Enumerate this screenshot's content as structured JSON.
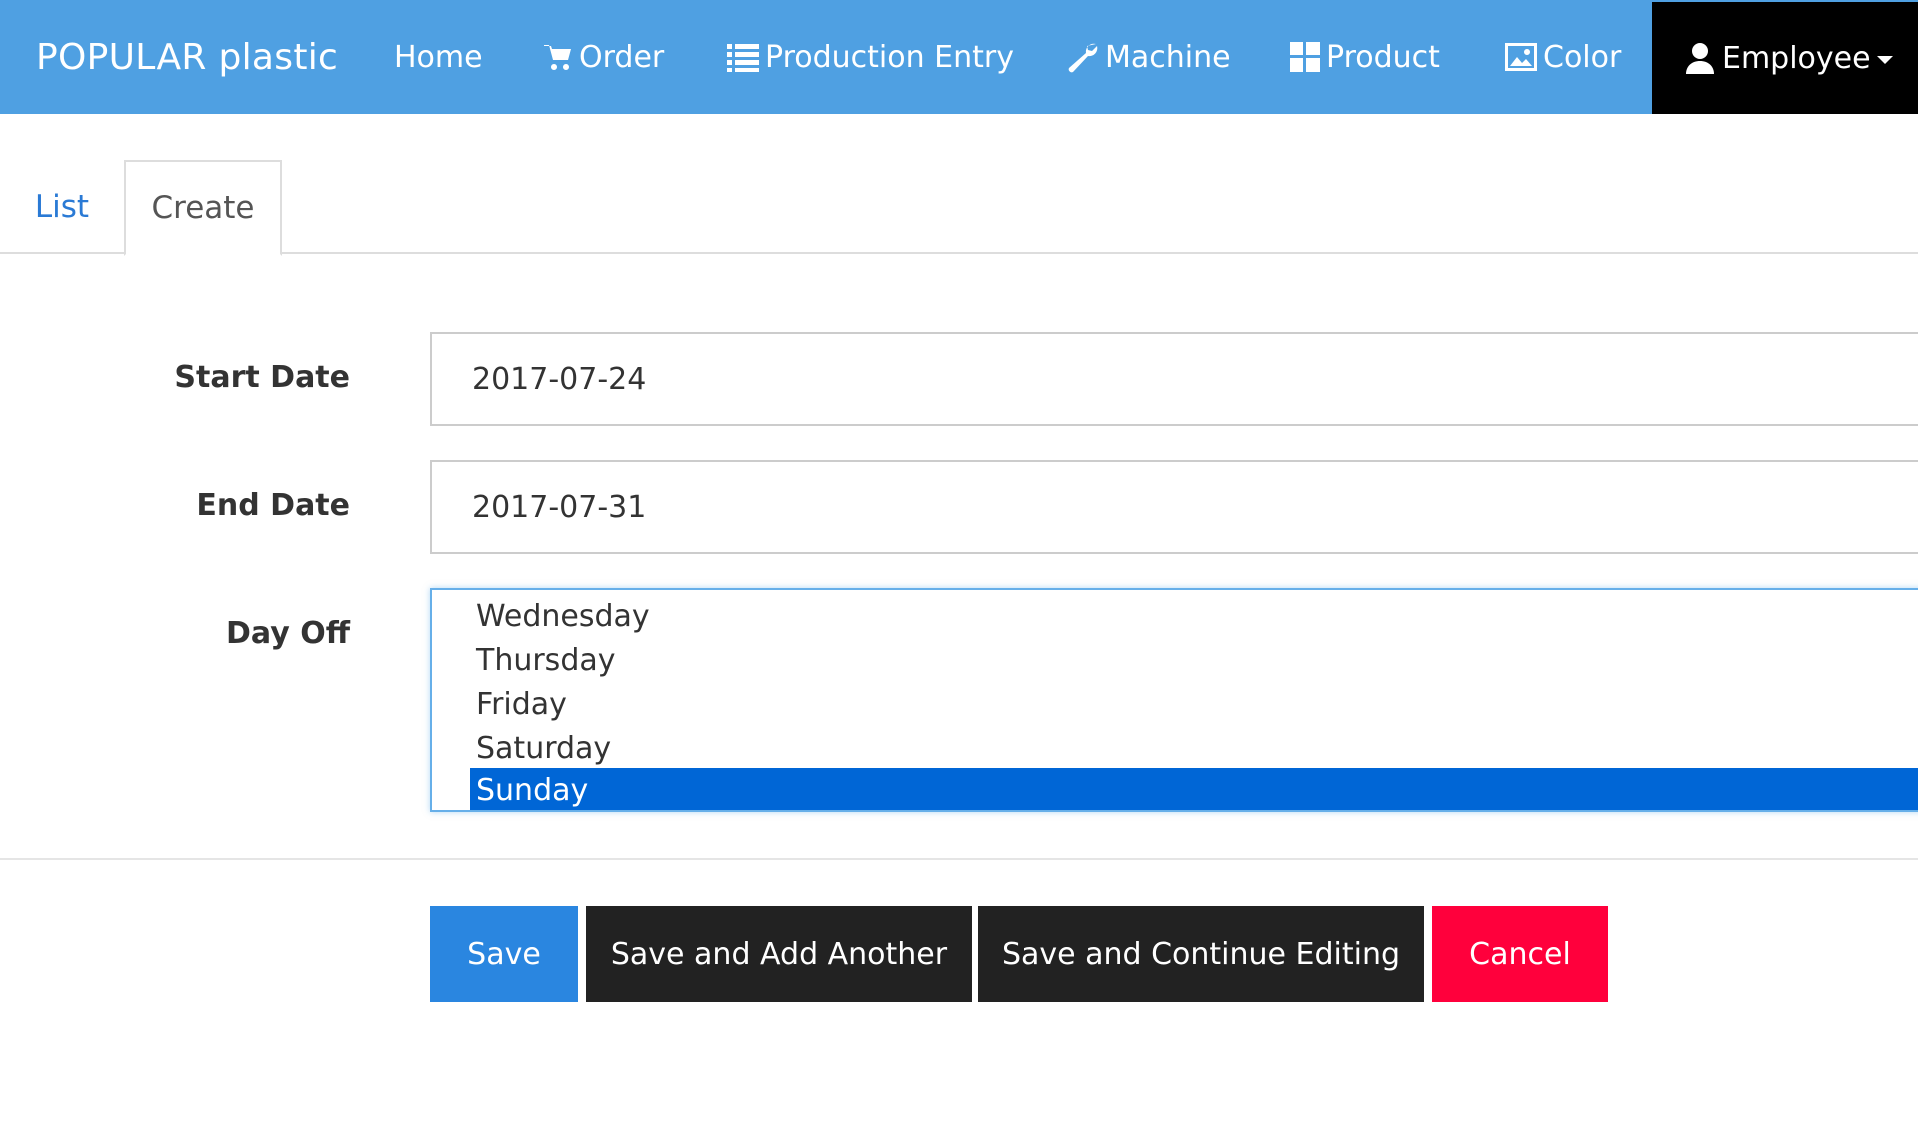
{
  "navbar": {
    "brand": "POPULAR plastic",
    "items": [
      {
        "label": "Home",
        "icon": ""
      },
      {
        "label": "Order",
        "icon": "cart-icon"
      },
      {
        "label": "Production Entry",
        "icon": "list-icon"
      },
      {
        "label": "Machine",
        "icon": "wrench-icon"
      },
      {
        "label": "Product",
        "icon": "grid-icon"
      },
      {
        "label": "Color",
        "icon": "picture-icon"
      },
      {
        "label": "Employee",
        "icon": "user-icon"
      }
    ],
    "colors": {
      "background": "#4fa0e2",
      "active": "#000000"
    }
  },
  "tabs": [
    {
      "label": "List",
      "active": false
    },
    {
      "label": "Create",
      "active": true
    }
  ],
  "form": {
    "start_date": {
      "label": "Start Date",
      "value": "2017-07-24"
    },
    "end_date": {
      "label": "End Date",
      "value": "2017-07-31"
    },
    "day_off": {
      "label": "Day Off",
      "options": [
        "Wednesday",
        "Thursday",
        "Friday",
        "Saturday",
        "Sunday"
      ],
      "selected": "Sunday"
    }
  },
  "buttons": {
    "save": "Save",
    "save_add": "Save and Add Another",
    "save_continue": "Save and Continue Editing",
    "cancel": "Cancel"
  },
  "colors": {
    "save": "#2a86e0",
    "secondary": "#222222",
    "cancel": "#ff003c",
    "selected_option": "#0066d6"
  }
}
